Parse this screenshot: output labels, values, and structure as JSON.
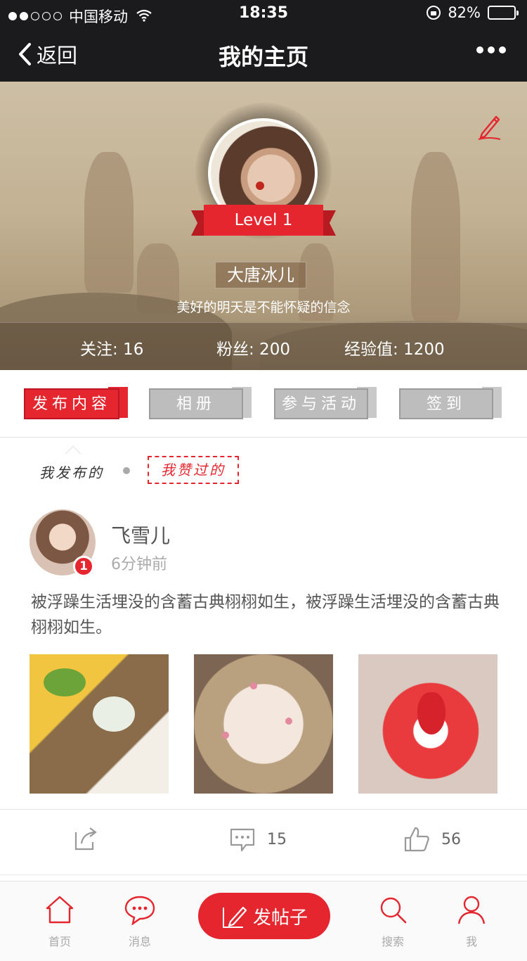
{
  "status_bar": {
    "carrier": "中国移动",
    "time": "18:35",
    "battery": "82%",
    "battery_level": 0.82,
    "signal_bars_filled": 2,
    "signal_bars_total": 5
  },
  "nav": {
    "back_label": "返回",
    "title": "我的主页"
  },
  "profile": {
    "level": "Level 1",
    "name": "大唐冰儿",
    "motto": "美好的明天是不能怀疑的信念",
    "stats": {
      "following": "关注: 16",
      "fans": "粉丝: 200",
      "exp": "经验值: 1200"
    }
  },
  "tabs": [
    {
      "label": "发布内容",
      "active": true
    },
    {
      "label": "相册",
      "active": false
    },
    {
      "label": "参与活动",
      "active": false
    },
    {
      "label": "签到",
      "active": false
    }
  ],
  "subtabs": {
    "published": "我发布的",
    "liked": "我赞过的"
  },
  "post": {
    "author": "飞雪儿",
    "time": "6分钟前",
    "badge": "1",
    "text": "被浮躁生活埋没的含蓄古典栩栩如生，被浮躁生活埋没的含蓄古典栩栩如生。",
    "images": [
      "bread-and-omelet",
      "decorated-cookies",
      "strawberry-dessert"
    ],
    "comments": "15",
    "likes": "56"
  },
  "tabbar": {
    "home": "首页",
    "messages": "消息",
    "post_button": "发帖子",
    "search": "搜索",
    "me": "我"
  },
  "colors": {
    "accent": "#e5262f",
    "topbar": "#1b1b1e",
    "inactive_tab": "#bdbdbd"
  },
  "icons": [
    "back-chevron-icon",
    "more-icon",
    "edit-pencil-icon",
    "share-icon",
    "comment-icon",
    "thumbs-up-icon",
    "home-icon",
    "message-icon",
    "pencil-icon",
    "search-icon",
    "user-icon",
    "wifi-icon",
    "lock-rotation-icon",
    "battery-icon"
  ]
}
